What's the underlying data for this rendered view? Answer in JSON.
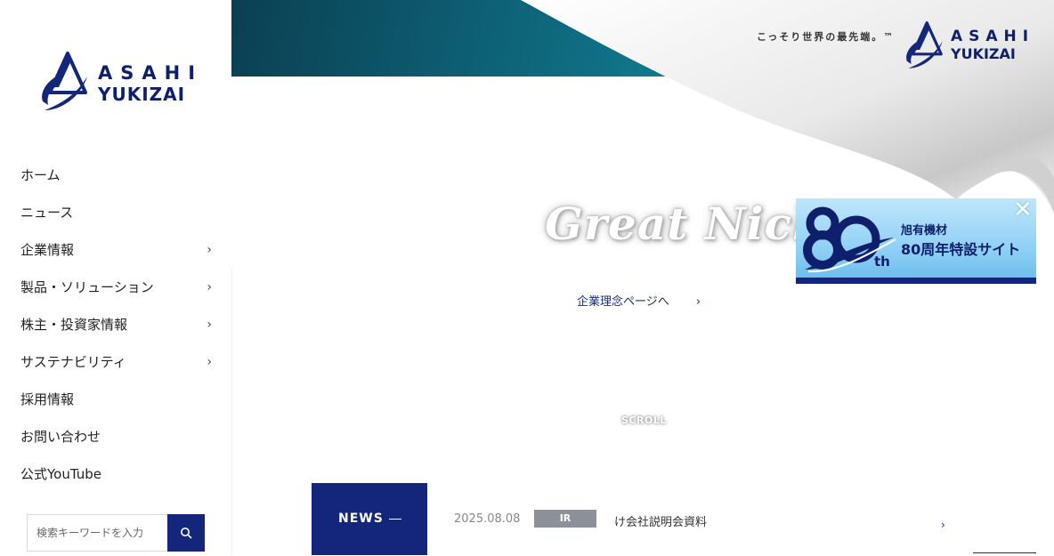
{
  "brand": {
    "logo_line1": "ASAHI",
    "logo_line2": "YUKIZAI",
    "color_primary": "#13267c"
  },
  "sidebar": {
    "items": [
      {
        "label": "ホーム",
        "has_children": false
      },
      {
        "label": "ニュース",
        "has_children": false
      },
      {
        "label": "企業情報",
        "has_children": true
      },
      {
        "label": "製品・ソリューション",
        "has_children": true
      },
      {
        "label": "株主・投資家情報",
        "has_children": true
      },
      {
        "label": "サステナビリティ",
        "has_children": true
      },
      {
        "label": "採用情報",
        "has_children": false
      },
      {
        "label": "お問い合わせ",
        "has_children": false
      },
      {
        "label": "公式YouTube",
        "has_children": false
      }
    ],
    "search": {
      "placeholder": "検索キーワードを入力",
      "value": "",
      "button_icon": "search-icon"
    }
  },
  "hero": {
    "tagline": "こっそり世界の最先端。™",
    "headline": "Great Niche",
    "philosophy_link": "企業理念ページへ",
    "scroll_label": "SCROLL"
  },
  "news": {
    "label": "NEWS",
    "items": [
      {
        "date": "2025.08.08",
        "tag": "IR",
        "title": "け会社説明会資料"
      }
    ]
  },
  "banner": {
    "number": "80",
    "suffix": "th",
    "line1": "旭有機材",
    "line2": "80周年特設サイト",
    "close_icon": "close-icon"
  }
}
